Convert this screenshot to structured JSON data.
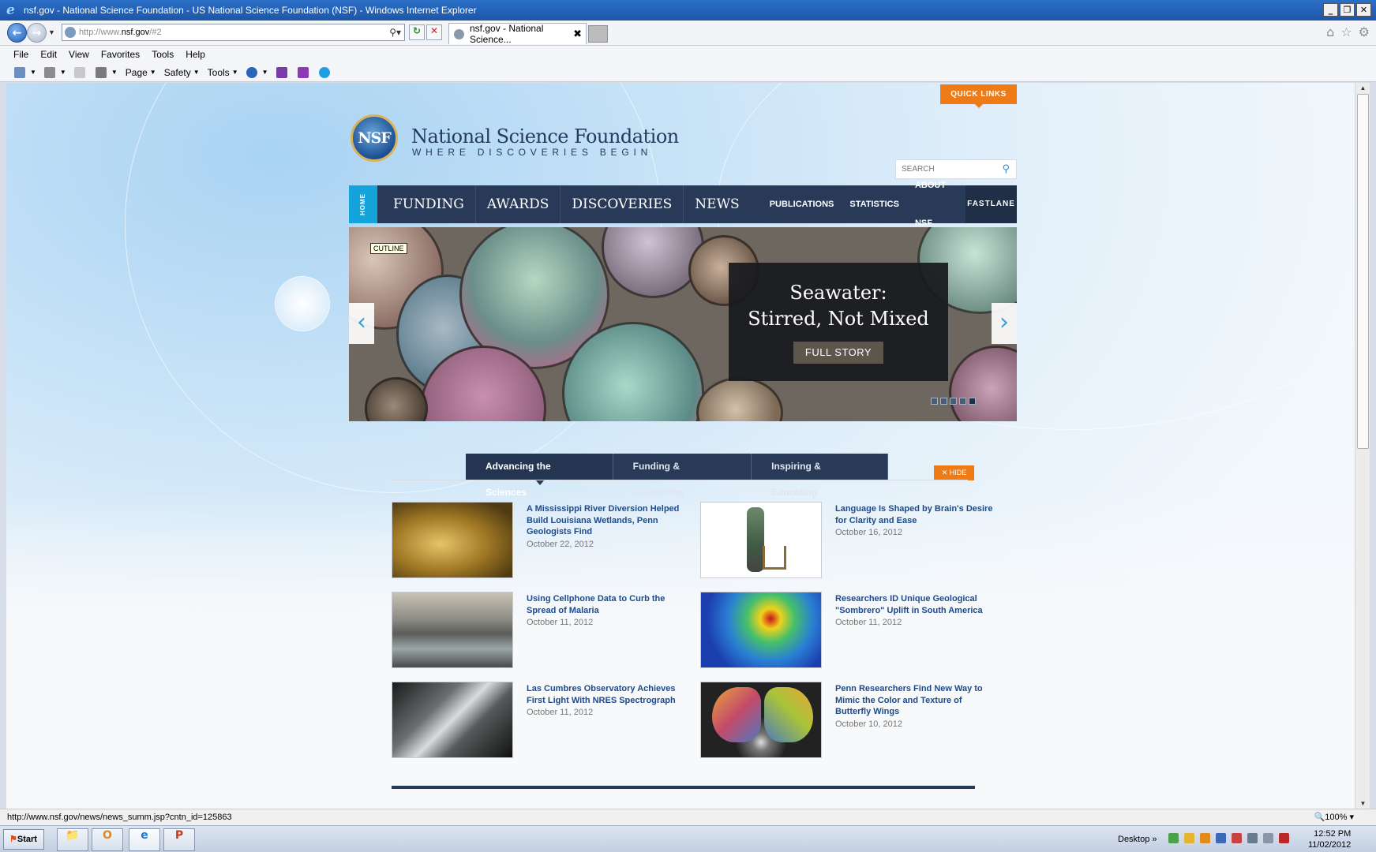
{
  "window": {
    "title": "nsf.gov - National Science Foundation - US National Science Foundation (NSF) - Windows Internet Explorer",
    "minimize": "_",
    "restore": "❐",
    "close": "✕"
  },
  "addressbar": {
    "url_prefix": "http://www.",
    "url_domain": "nsf.gov",
    "url_suffix": "/#2",
    "tab_label": "nsf.gov - National Science...",
    "tab_close": "✖"
  },
  "menu": [
    "File",
    "Edit",
    "View",
    "Favorites",
    "Tools",
    "Help"
  ],
  "commandbar": {
    "page": "Page",
    "safety": "Safety",
    "tools": "Tools"
  },
  "nsf": {
    "quick_links": "QUICK LINKS",
    "logo_text": "NSF",
    "title": "National Science Foundation",
    "tagline": "WHERE DISCOVERIES BEGIN",
    "search_placeholder": "SEARCH",
    "nav": {
      "home": "HOME",
      "main": [
        "FUNDING",
        "AWARDS",
        "DISCOVERIES",
        "NEWS"
      ],
      "secondary": [
        "PUBLICATIONS",
        "STATISTICS",
        "ABOUT NSF"
      ],
      "fastlane": "FASTLANE"
    },
    "hero": {
      "cutline": "CUTLINE",
      "headline_line1": "Seawater:",
      "headline_line2": "Stirred, Not Mixed",
      "button": "FULL STORY",
      "prev_arrow": "‹",
      "next_arrow": "›",
      "slide_count": 5,
      "active_slide": 5
    },
    "tabs": [
      "Advancing the Sciences",
      "Funding & Supporting",
      "Inspiring & Educating"
    ],
    "active_tab": "Advancing the Sciences",
    "hide": "✕ HIDE",
    "news": [
      {
        "headline": "A Mississippi River Diversion Helped Build Louisiana Wetlands, Penn Geologists Find",
        "date": "October 22, 2012",
        "thumb": "satellite-delta"
      },
      {
        "headline": "Language Is Shaped by Brain's Desire for Clarity and Ease",
        "date": "October 16, 2012",
        "thumb": "figure-chair"
      },
      {
        "headline": "Using Cellphone Data to Curb the Spread of Malaria",
        "date": "October 11, 2012",
        "thumb": "city-traffic"
      },
      {
        "headline": "Researchers ID Unique Geological \"Sombrero\" Uplift in South America",
        "date": "October 11, 2012",
        "thumb": "heatmap"
      },
      {
        "headline": "Las Cumbres Observatory Achieves First Light With NRES Spectrograph",
        "date": "October 11, 2012",
        "thumb": "observatory"
      },
      {
        "headline": "Penn Researchers Find New Way to Mimic the Color and Texture of Butterfly Wings",
        "date": "October 10, 2012",
        "thumb": "butterfly"
      }
    ]
  },
  "statusbar": {
    "url": "http://www.nsf.gov/news/news_summ.jsp?cntn_id=125863",
    "zoom": "100%"
  },
  "taskbar": {
    "start": "Start",
    "desktop": "Desktop",
    "time": "12:52 PM",
    "date": "11/02/2012"
  },
  "colors": {
    "nsf_navy": "#283a57",
    "nsf_orange": "#ee7b16",
    "nsf_blue": "#15a3dc",
    "link_blue": "#1e4a8a"
  }
}
